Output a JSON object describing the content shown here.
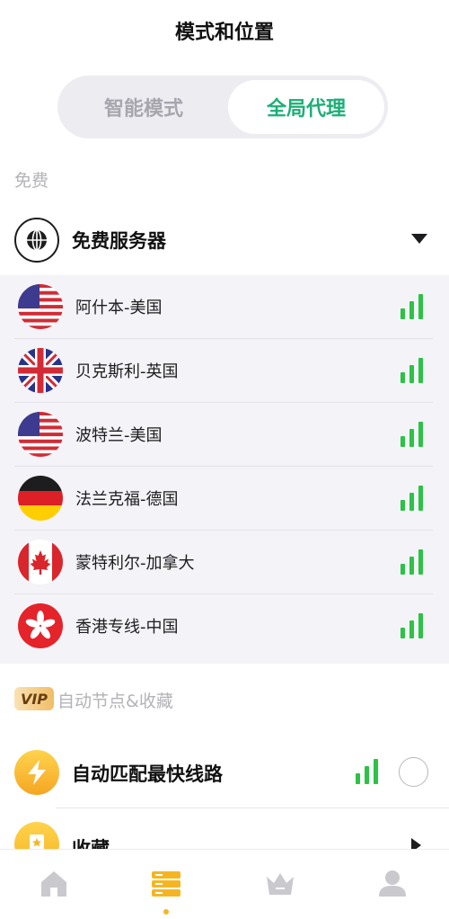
{
  "header": {
    "title": "模式和位置"
  },
  "mode_toggle": {
    "smart": "智能模式",
    "global": "全局代理",
    "selected": "global"
  },
  "free_section": {
    "label": "免费",
    "group_title": "免费服务器",
    "servers": [
      {
        "name": "阿什本-美国",
        "flag": "us-flag-icon"
      },
      {
        "name": "贝克斯利-英国",
        "flag": "uk-flag-icon"
      },
      {
        "name": "波特兰-美国",
        "flag": "us-flag-icon"
      },
      {
        "name": "法兰克福-德国",
        "flag": "de-flag-icon"
      },
      {
        "name": "蒙特利尔-加拿大",
        "flag": "ca-flag-icon"
      },
      {
        "name": "香港专线-中国",
        "flag": "hk-flag-icon"
      }
    ]
  },
  "vip_section": {
    "badge": "VIP",
    "label": "自动节点&收藏",
    "auto_title": "自动匹配最快线路",
    "favorites_title": "收藏"
  },
  "colors": {
    "accent": "#1cae77",
    "signal": "#2cc246",
    "gold": "#f5b523"
  },
  "tabbar": {
    "tabs": [
      "home-icon",
      "server-list-icon",
      "crown-icon",
      "profile-icon"
    ],
    "active": 1
  }
}
